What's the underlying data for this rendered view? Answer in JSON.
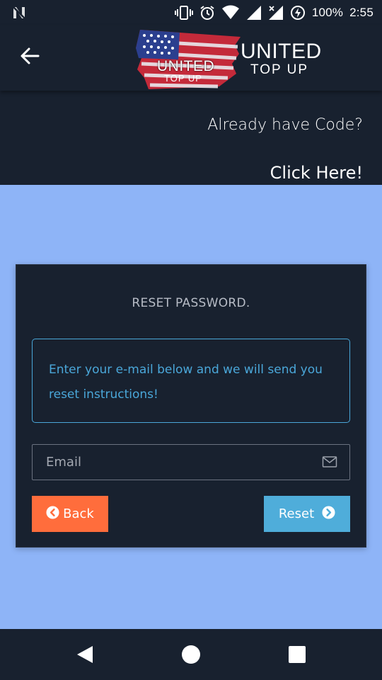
{
  "status_bar": {
    "battery_text": "100%",
    "time": "2:55",
    "icons": [
      "n-notification-icon",
      "vibrate-icon",
      "alarm-icon",
      "wifi-icon",
      "signal-icon",
      "signal-no-data-icon",
      "battery-charging-icon"
    ]
  },
  "header": {
    "logo": {
      "flag_line1": "UNITED",
      "flag_line2": "TOP UP",
      "title_line1": "UNITED",
      "title_line2": "TOP UP"
    },
    "already_text": "Already have Code?",
    "click_here": "Click Here!"
  },
  "card": {
    "title": "RESET PASSWORD.",
    "info": "Enter your e-mail below and we will send you reset instructions!",
    "email": {
      "value": "",
      "placeholder": "Email"
    },
    "back_label": "Back",
    "reset_label": "Reset"
  },
  "colors": {
    "dark_bg": "#18212f",
    "page_bg": "#8eb4f7",
    "accent_blue": "#4aa7d9",
    "back_orange": "#ff6d3c",
    "reset_blue": "#4fadda"
  },
  "nav_bar": {
    "buttons": [
      "back-triangle-icon",
      "home-circle-icon",
      "recents-square-icon"
    ]
  }
}
